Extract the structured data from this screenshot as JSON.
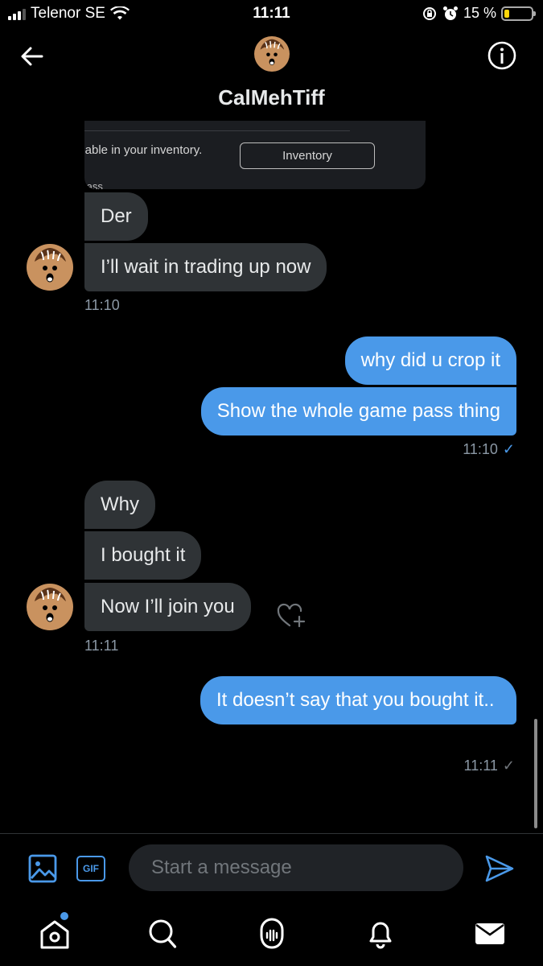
{
  "status_bar": {
    "carrier": "Telenor SE",
    "time": "11:11",
    "battery": "15 %"
  },
  "header": {
    "name": "CalMehTiff"
  },
  "card": {
    "inventory_text": "ilable in your inventory.",
    "inventory_button": "Inventory",
    "pass_label": "Pass"
  },
  "messages": [
    {
      "from": "them",
      "text": "Der"
    },
    {
      "from": "them",
      "text": "I’ll wait in trading up now"
    },
    {
      "from": "them",
      "text": "11:10",
      "kind": "timestamp"
    },
    {
      "from": "me",
      "text": "why did u crop it"
    },
    {
      "from": "me",
      "text": "Show the whole game pass thing"
    },
    {
      "from": "me",
      "text": "11:10",
      "kind": "timestamp"
    },
    {
      "from": "them",
      "text": "Why"
    },
    {
      "from": "them",
      "text": "I bought it"
    },
    {
      "from": "them",
      "text": "Now I’ll join you"
    },
    {
      "from": "them",
      "text": "11:11",
      "kind": "timestamp"
    },
    {
      "from": "me",
      "text": "It doesn’t say that you bought it.."
    },
    {
      "from": "me",
      "text": "11:11",
      "kind": "timestamp"
    }
  ],
  "composer": {
    "placeholder": "Start a message",
    "gif_label": "GIF"
  },
  "colors": {
    "accent": "#4a99e9",
    "incoming_bubble": "#2f3336",
    "background": "#000000"
  },
  "icons": [
    "back-arrow-icon",
    "info-icon",
    "heart-react-icon",
    "image-icon",
    "gif-icon",
    "send-icon",
    "home-icon",
    "search-icon",
    "spaces-icon",
    "notifications-icon",
    "messages-icon"
  ]
}
